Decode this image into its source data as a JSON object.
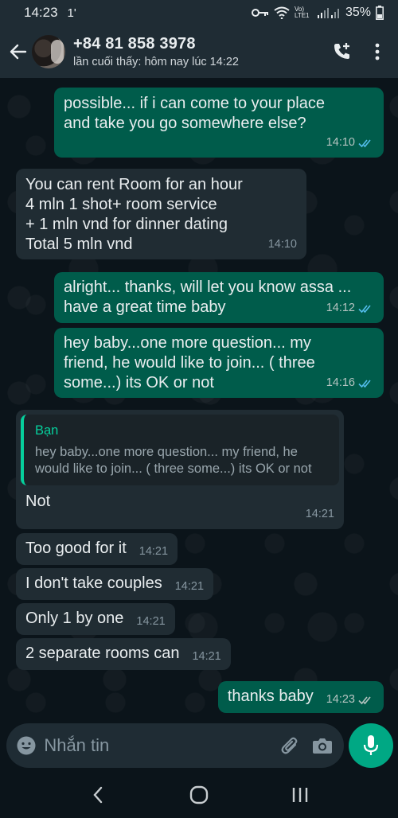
{
  "status_bar": {
    "time": "14:23",
    "extra_indicator": "1'",
    "network": "Vo) LTE1",
    "battery": "35%"
  },
  "header": {
    "contact_name": "+84 81 858 3978",
    "last_seen": "lần cuối thấy: hôm nay lúc 14:22"
  },
  "messages": [
    {
      "dir": "out",
      "text": "possible... if i can come to your place\nand take you go somewhere else?",
      "time": "14:10"
    },
    {
      "dir": "in",
      "text": "You can rent Room for an hour\n4 mln 1 shot+ room service\n+ 1 mln vnd for dinner dating\nTotal 5 mln vnd",
      "time": "14:10"
    },
    {
      "dir": "out",
      "text": "alright... thanks, will let you know assa ...\nhave a great time baby",
      "time": "14:12"
    },
    {
      "dir": "out",
      "text": "hey baby...one more question... my\nfriend, he would like to join... ( three\nsome...) its OK or not",
      "time": "14:16"
    },
    {
      "dir": "in",
      "quote_author": "Bạn",
      "quote_text": "hey baby...one more question... my friend, he would like to join... ( three some...) its OK or not",
      "text": "Not",
      "time": "14:21"
    },
    {
      "dir": "in",
      "text": "Too good for it",
      "time": "14:21"
    },
    {
      "dir": "in",
      "text": "I don't take couples",
      "time": "14:21"
    },
    {
      "dir": "in",
      "text": "Only 1 by one",
      "time": "14:21"
    },
    {
      "dir": "in",
      "text": "2 separate rooms can",
      "time": "14:21"
    },
    {
      "dir": "out",
      "text": "thanks baby",
      "time": "14:23"
    }
  ],
  "composer": {
    "placeholder": "Nhắn tin"
  },
  "icons": {
    "back": "arrow-left-icon",
    "add_call": "phone-plus-icon",
    "menu": "more-vertical-icon",
    "emoji": "emoji-icon",
    "attach": "paperclip-icon",
    "camera": "camera-icon",
    "mic": "mic-icon",
    "read_ticks": "double-check-icon"
  },
  "colors": {
    "outgoing_bubble": "#005c4b",
    "incoming_bubble": "#202c33",
    "read_tick": "#53bdeb",
    "accent": "#00a884"
  }
}
